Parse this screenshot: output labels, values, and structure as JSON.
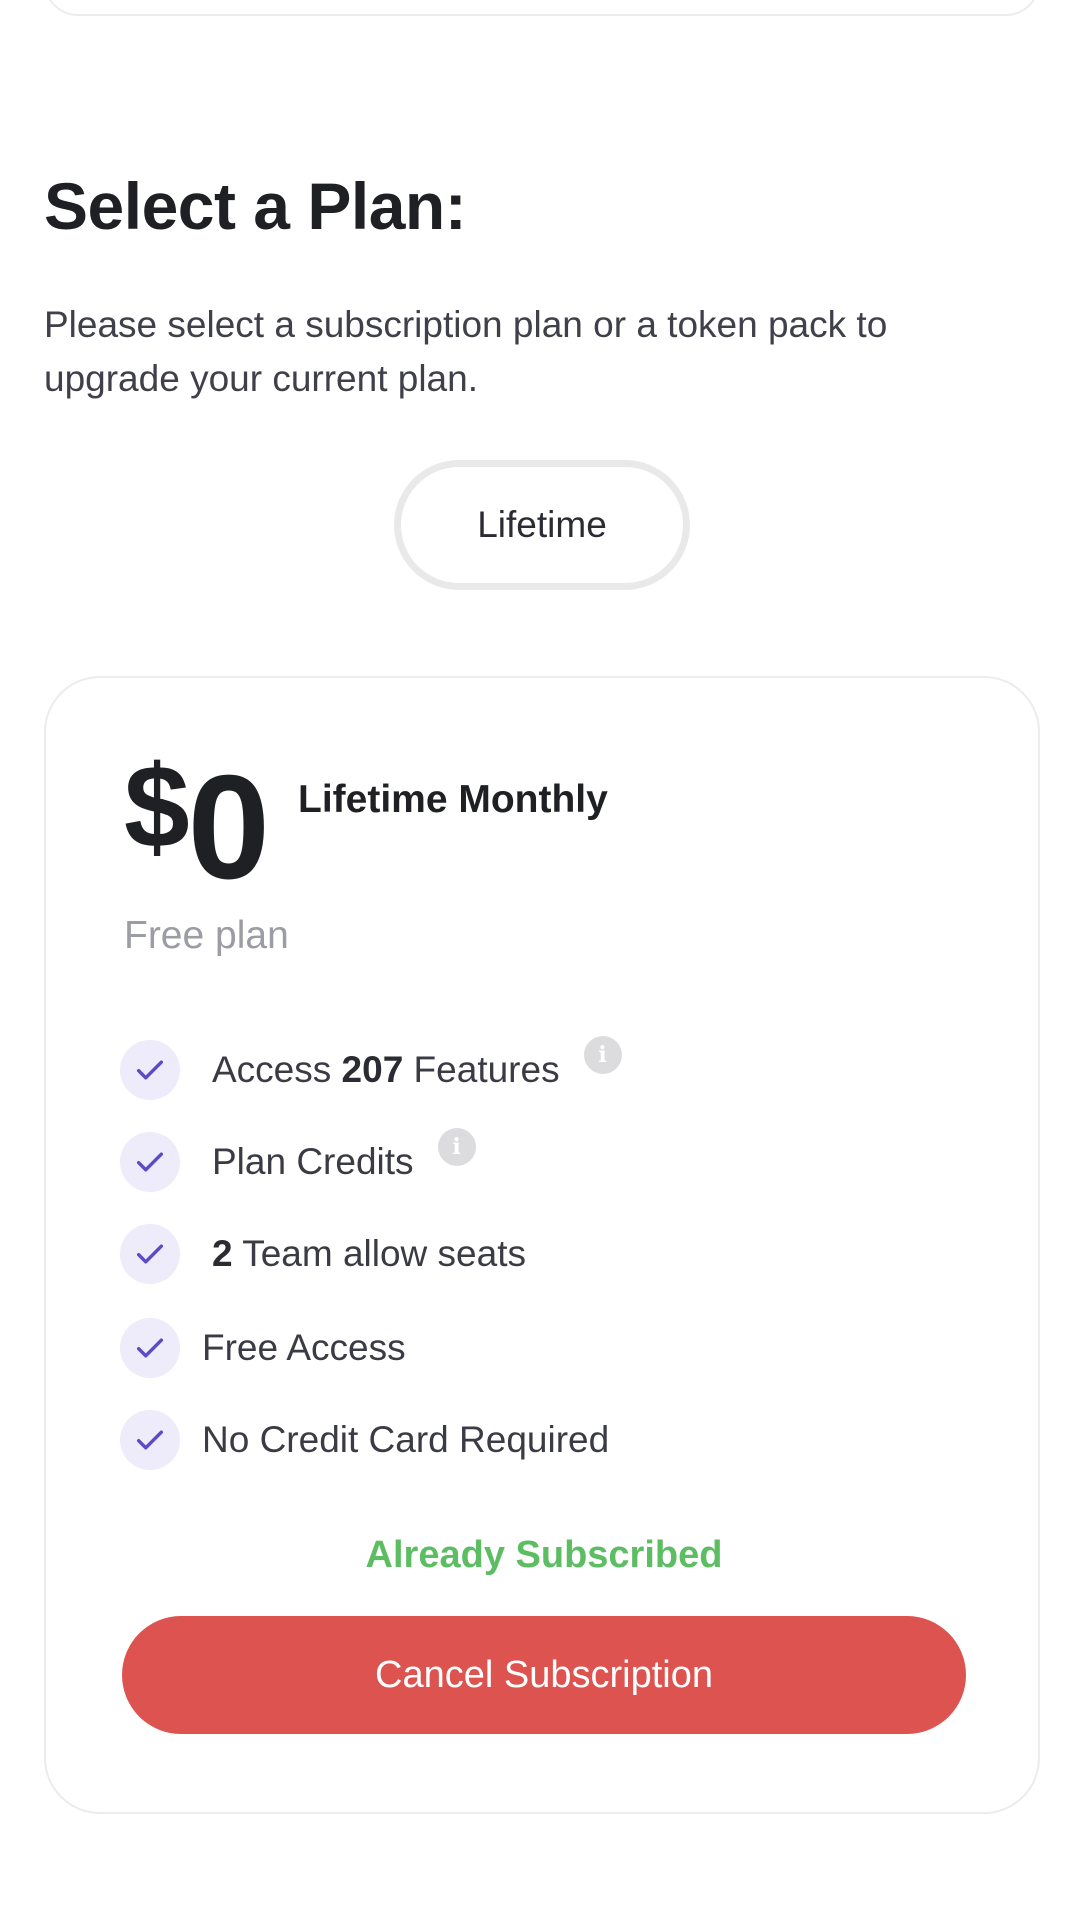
{
  "header": {
    "title": "Select a Plan:",
    "description": "Please select a subscription plan or a token pack to upgrade your current plan."
  },
  "billing_toggle": {
    "selected_label": "Lifetime"
  },
  "plan": {
    "currency": "$",
    "amount": "0",
    "name": "Lifetime Monthly",
    "subtitle": "Free plan",
    "features": [
      {
        "prefix": "Access ",
        "bold": "207",
        "suffix": " Features",
        "has_info": true
      },
      {
        "prefix": "Plan Credits",
        "bold": "",
        "suffix": "",
        "has_info": true
      },
      {
        "prefix": "",
        "bold": "2",
        "suffix": " Team allow seats",
        "has_info": false
      },
      {
        "prefix": "Free Access",
        "bold": "",
        "suffix": "",
        "has_info": false
      },
      {
        "prefix": "No Credit Card Required",
        "bold": "",
        "suffix": "",
        "has_info": false
      }
    ],
    "status_text": "Already Subscribed",
    "cancel_label": "Cancel Subscription",
    "info_glyph": "i"
  },
  "colors": {
    "accent_purple": "#5b4bc4",
    "check_bg": "#eeebfa",
    "status_green": "#5dbd63",
    "danger_red": "#dd534f"
  },
  "icons": {
    "check": "check-icon",
    "info": "info-icon"
  }
}
